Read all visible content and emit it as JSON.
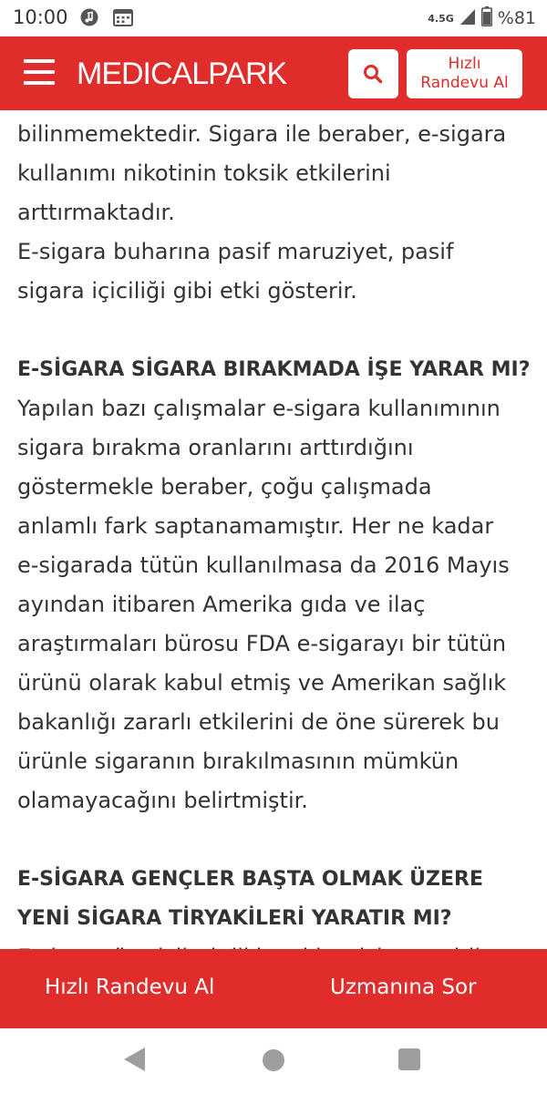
{
  "status_bar": {
    "time": "10:00",
    "network": "4.5G",
    "battery": "%81",
    "icons": [
      "music-icon",
      "calendar-icon",
      "signal-icon",
      "battery-icon"
    ]
  },
  "header": {
    "brand": "MEDICALPARK",
    "search_icon": "search-icon",
    "menu_icon": "menu-icon",
    "appointment_line1": "Hızlı",
    "appointment_line2": "Randevu Al",
    "bg_color": "#e02d2b"
  },
  "article": {
    "lines1": [
      "bilinmemektedir. Sigara ile beraber, e-sigara",
      "kullanımı nikotinin toksik etkilerini",
      "arttırmaktadır.",
      "E-sigara buharına pasif maruziyet, pasif",
      "sigara içiciliği gibi etki gösterir."
    ],
    "heading1": "E-SİGARA SİGARA BIRAKMADA İŞE YARAR MI?",
    "lines2": [
      "Yapılan bazı çalışmalar e-sigara kullanımının",
      "sigara bırakma oranlarını arttırdığını",
      "göstermekle beraber, çoğu çalışmada",
      "anlamlı fark saptanamamıştır. Her ne kadar",
      "e-sigarada tütün kullanılmasa da 2016 Mayıs",
      "ayından itibaren Amerika gıda ve ilaç",
      "araştırmaları bürosu FDA e-sigarayı bir tütün",
      "ürünü olarak kabul etmiş ve Amerikan sağlık",
      "bakanlığı zararlı etkilerini de öne sürerek bu",
      "ürünle sigaranın bırakılmasının mümkün",
      "olamayacağını belirtmiştir."
    ],
    "heading2_line1": "E-SİGARA GENÇLER BAŞTA OLMAK ÜZERE",
    "heading2_line2": "YENİ SİGARA TİRYAKİLERİ YARATIR MI?",
    "partial_line": "E-sigara üreticileri dikkatçi içecisine çeşitli"
  },
  "bottom_bar": {
    "left_label": "Hızlı Randevu Al",
    "right_label": "Uzmanına Sor"
  },
  "nav_bar": {
    "icons": [
      "back-icon",
      "home-icon",
      "recent-apps-icon"
    ]
  }
}
